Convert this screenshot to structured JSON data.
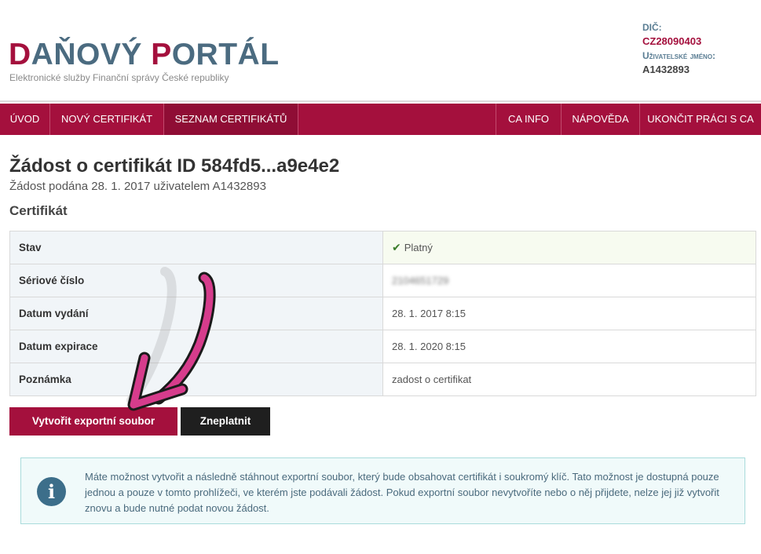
{
  "header": {
    "logo_parts": [
      {
        "text": "D",
        "accent": true
      },
      {
        "text": "AŇOVÝ ",
        "accent": false
      },
      {
        "text": "P",
        "accent": true
      },
      {
        "text": "ORTÁL",
        "accent": false
      }
    ],
    "tagline": "Elektronické služby Finanční správy České republiky",
    "dic_label": "DIČ:",
    "dic_value": "CZ28090403",
    "username_label": "Uživatelské jméno:",
    "username_value": "A1432893"
  },
  "nav": {
    "items": [
      {
        "label": "ÚVOD",
        "active": false
      },
      {
        "label": "NOVÝ CERTIFIKÁT",
        "active": false
      },
      {
        "label": "SEZNAM CERTIFIKÁTŮ",
        "active": true
      }
    ],
    "right_items": [
      {
        "label": "CA INFO"
      },
      {
        "label": "NÁPOVĚDA"
      },
      {
        "label": "UKONČIT PRÁCI S CA"
      }
    ]
  },
  "page": {
    "title": "Žádost o certifikát ID 584fd5...a9e4e2",
    "subtitle": "Žádost podána 28. 1. 2017 uživatelem A1432893",
    "section_title": "Certifikát"
  },
  "certificate": {
    "rows": [
      {
        "key": "Stav",
        "value": "Platný",
        "icon": "check-icon"
      },
      {
        "key": "Sériové číslo",
        "value": "2104651729",
        "blurred": true
      },
      {
        "key": "Datum vydání",
        "value": "28. 1. 2017 8:15"
      },
      {
        "key": "Datum expirace",
        "value": "28. 1. 2020 8:15"
      },
      {
        "key": "Poznámka",
        "value": "zadost o certifikat"
      }
    ]
  },
  "actions": {
    "export_label": "Vytvořit exportní soubor",
    "invalidate_label": "Zneplatnit"
  },
  "info": {
    "text": "Máte možnost vytvořit a následně stáhnout exportní soubor, který bude obsahovat certifikát i soukromý klíč. Tato možnost je dostupná pouze jednou a pouze v tomto prohlížeči, ve kterém jste podávali žádost. Pokud exportní soubor nevytvoříte nebo o něj přijdete, nelze jej již vytvořit znovu a bude nutné podat novou žádost."
  },
  "colors": {
    "brand": "#a4103d",
    "logo_blue": "#4b6b80",
    "info_icon": "#3c6e8a",
    "arrow": "#d63c8c"
  }
}
